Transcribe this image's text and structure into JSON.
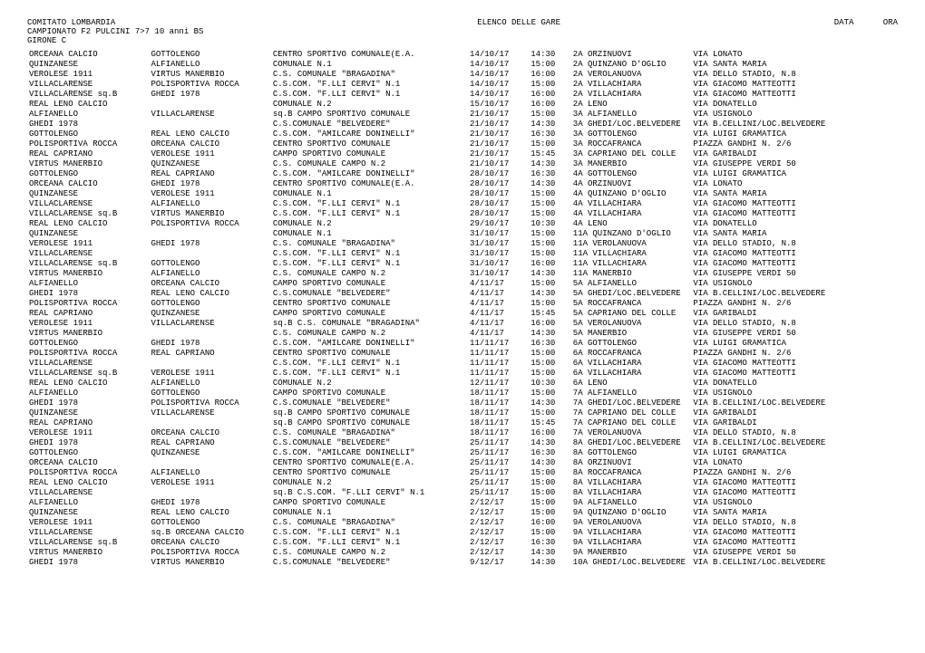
{
  "header": {
    "comitato": "COMITATO LOMBARDIA",
    "elenco": "ELENCO DELLE GARE",
    "campionato": "CAMPIONATO F2 PULCINI 7>7 10 anni    BS",
    "girone": "GIRONE C",
    "data_label": "DATA",
    "ora_label": "ORA"
  },
  "rows": [
    [
      "ORCEANA CALCIO",
      "GOTTOLENGO",
      "CENTRO SPORTIVO COMUNALE(E.A.",
      "14/10/17",
      "14:30",
      "2A ORZINUOVI",
      "VIA LONATO"
    ],
    [
      "QUINZANESE",
      "ALFIANELLO",
      "COMUNALE N.1",
      "14/10/17",
      "15:00",
      "2A QUINZANO D'OGLIO",
      "VIA SANTA MARIA"
    ],
    [
      "VEROLESE 1911",
      "VIRTUS MANERBIO",
      "C.S. COMUNALE \"BRAGADINA\"",
      "14/10/17",
      "16:00",
      "2A VEROLANUOVA",
      "VIA DELLO STADIO, N.8"
    ],
    [
      "VILLACLARENSE",
      "POLISPORTIVA ROCCA",
      "C.S.COM. \"F.LLI CERVI\" N.1",
      "14/10/17",
      "15:00",
      "2A VILLACHIARA",
      "VIA GIACOMO MATTEOTTI"
    ],
    [
      "VILLACLARENSE  sq.B",
      "GHEDI 1978",
      "C.S.COM. \"F.LLI CERVI\" N.1",
      "14/10/17",
      "16:00",
      "2A VILLACHIARA",
      "VIA GIACOMO MATTEOTTI"
    ],
    [
      "REAL LENO CALCIO",
      "",
      "COMUNALE N.2",
      "15/10/17",
      "16:00",
      "2A LENO",
      "VIA DONATELLO"
    ],
    [
      "ALFIANELLO",
      "VILLACLARENSE",
      "sq.B CAMPO SPORTIVO COMUNALE",
      "21/10/17",
      "15:00",
      "3A ALFIANELLO",
      "VIA USIGNOLO"
    ],
    [
      "GHEDI 1978",
      "",
      "C.S.COMUNALE \"BELVEDERE\"",
      "21/10/17",
      "14:30",
      "3A GHEDI/LOC.BELVEDERE",
      "VIA B.CELLINI/LOC.BELVEDERE"
    ],
    [
      "GOTTOLENGO",
      "REAL LENO CALCIO",
      "C.S.COM. \"AMILCARE DONINELLI\"",
      "21/10/17",
      "16:30",
      "3A GOTTOLENGO",
      "VIA LUIGI GRAMATICA"
    ],
    [
      "POLISPORTIVA ROCCA",
      "ORCEANA CALCIO",
      "CENTRO SPORTIVO COMUNALE",
      "21/10/17",
      "15:00",
      "3A ROCCAFRANCA",
      "PIAZZA GANDHI N. 2/6"
    ],
    [
      "REAL CAPRIANO",
      "VEROLESE 1911",
      "CAMPO SPORTIVO COMUNALE",
      "21/10/17",
      "15:45",
      "3A CAPRIANO DEL COLLE",
      "VIA GARIBALDI"
    ],
    [
      "VIRTUS MANERBIO",
      "QUINZANESE",
      "C.S. COMUNALE CAMPO N.2",
      "21/10/17",
      "14:30",
      "3A MANERBIO",
      "VIA GIUSEPPE VERDI 50"
    ],
    [
      "GOTTOLENGO",
      "REAL CAPRIANO",
      "C.S.COM. \"AMILCARE DONINELLI\"",
      "28/10/17",
      "16:30",
      "4A GOTTOLENGO",
      "VIA LUIGI GRAMATICA"
    ],
    [
      "ORCEANA CALCIO",
      "GHEDI 1978",
      "CENTRO SPORTIVO COMUNALE(E.A.",
      "28/10/17",
      "14:30",
      "4A ORZINUOVI",
      "VIA LONATO"
    ],
    [
      "QUINZANESE",
      "VEROLESE 1911",
      "COMUNALE N.1",
      "28/10/17",
      "15:00",
      "4A QUINZANO D'OGLIO",
      "VIA SANTA MARIA"
    ],
    [
      "VILLACLARENSE",
      "ALFIANELLO",
      "C.S.COM. \"F.LLI CERVI\" N.1",
      "28/10/17",
      "15:00",
      "4A VILLACHIARA",
      "VIA GIACOMO MATTEOTTI"
    ],
    [
      "VILLACLARENSE  sq.B",
      "VIRTUS MANERBIO",
      "C.S.COM. \"F.LLI CERVI\" N.1",
      "28/10/17",
      "15:00",
      "4A VILLACHIARA",
      "VIA GIACOMO MATTEOTTI"
    ],
    [
      "REAL LENO CALCIO",
      "POLISPORTIVA ROCCA",
      "COMUNALE N.2",
      "29/10/17",
      "10:30",
      "4A LENO",
      "VIA DONATELLO"
    ],
    [
      "QUINZANESE",
      "",
      "COMUNALE N.1",
      "31/10/17",
      "15:00",
      "11A QUINZANO D'OGLIO",
      "VIA SANTA MARIA"
    ],
    [
      "VEROLESE 1911",
      "GHEDI 1978",
      "C.S. COMUNALE \"BRAGADINA\"",
      "31/10/17",
      "15:00",
      "11A VEROLANUOVA",
      "VIA DELLO STADIO, N.8"
    ],
    [
      "VILLACLARENSE",
      "",
      "C.S.COM. \"F.LLI CERVI\" N.1",
      "31/10/17",
      "15:00",
      "11A VILLACHIARA",
      "VIA GIACOMO MATTEOTTI"
    ],
    [
      "VILLACLARENSE  sq.B",
      "GOTTOLENGO",
      "C.S.COM. \"F.LLI CERVI\" N.1",
      "31/10/17",
      "16:00",
      "11A VILLACHIARA",
      "VIA GIACOMO MATTEOTTI"
    ],
    [
      "VIRTUS MANERBIO",
      "ALFIANELLO",
      "C.S. COMUNALE CAMPO N.2",
      "31/10/17",
      "14:30",
      "11A MANERBIO",
      "VIA GIUSEPPE VERDI 50"
    ],
    [
      "ALFIANELLO",
      "ORCEANA CALCIO",
      "CAMPO SPORTIVO COMUNALE",
      "4/11/17",
      "15:00",
      "5A ALFIANELLO",
      "VIA USIGNOLO"
    ],
    [
      "GHEDI 1978",
      "REAL LENO CALCIO",
      "C.S.COMUNALE \"BELVEDERE\"",
      "4/11/17",
      "14:30",
      "5A GHEDI/LOC.BELVEDERE",
      "VIA B.CELLINI/LOC.BELVEDERE"
    ],
    [
      "POLISPORTIVA ROCCA",
      "GOTTOLENGO",
      "CENTRO SPORTIVO COMUNALE",
      "4/11/17",
      "15:00",
      "5A ROCCAFRANCA",
      "PIAZZA GANDHI N. 2/6"
    ],
    [
      "REAL CAPRIANO",
      "QUINZANESE",
      "CAMPO SPORTIVO COMUNALE",
      "4/11/17",
      "15:45",
      "5A CAPRIANO DEL COLLE",
      "VIA GARIBALDI"
    ],
    [
      "VEROLESE 1911",
      "VILLACLARENSE",
      "sq.B C.S. COMUNALE \"BRAGADINA\"",
      "4/11/17",
      "16:00",
      "5A VEROLANUOVA",
      "VIA DELLO STADIO, N.8"
    ],
    [
      "VIRTUS MANERBIO",
      "",
      "C.S. COMUNALE CAMPO N.2",
      "4/11/17",
      "14:30",
      "5A MANERBIO",
      "VIA GIUSEPPE VERDI 50"
    ],
    [
      "GOTTOLENGO",
      "GHEDI 1978",
      "C.S.COM. \"AMILCARE DONINELLI\"",
      "11/11/17",
      "16:30",
      "6A GOTTOLENGO",
      "VIA LUIGI GRAMATICA"
    ],
    [
      "POLISPORTIVA ROCCA",
      "REAL CAPRIANO",
      "CENTRO SPORTIVO COMUNALE",
      "11/11/17",
      "15:00",
      "6A ROCCAFRANCA",
      "PIAZZA GANDHI N. 2/6"
    ],
    [
      "VILLACLARENSE",
      "",
      "C.S.COM. \"F.LLI CERVI\" N.1",
      "11/11/17",
      "15:00",
      "6A VILLACHIARA",
      "VIA GIACOMO MATTEOTTI"
    ],
    [
      "VILLACLARENSE  sq.B",
      "VEROLESE 1911",
      "C.S.COM. \"F.LLI CERVI\" N.1",
      "11/11/17",
      "15:00",
      "6A VILLACHIARA",
      "VIA GIACOMO MATTEOTTI"
    ],
    [
      "REAL LENO CALCIO",
      "ALFIANELLO",
      "COMUNALE N.2",
      "12/11/17",
      "10:30",
      "6A LENO",
      "VIA DONATELLO"
    ],
    [
      "ALFIANELLO",
      "GOTTOLENGO",
      "CAMPO SPORTIVO COMUNALE",
      "18/11/17",
      "15:00",
      "7A ALFIANELLO",
      "VIA USIGNOLO"
    ],
    [
      "GHEDI 1978",
      "POLISPORTIVA ROCCA",
      "C.S.COMUNALE \"BELVEDERE\"",
      "18/11/17",
      "14:30",
      "7A GHEDI/LOC.BELVEDERE",
      "VIA B.CELLINI/LOC.BELVEDERE"
    ],
    [
      "QUINZANESE",
      "VILLACLARENSE",
      "sq.B CAMPO SPORTIVO COMUNALE",
      "18/11/17",
      "15:00",
      "7A CAPRIANO DEL COLLE",
      "VIA GARIBALDI"
    ],
    [
      "REAL CAPRIANO",
      "",
      "sq.B CAMPO SPORTIVO COMUNALE",
      "18/11/17",
      "15:45",
      "7A CAPRIANO DEL COLLE",
      "VIA GARIBALDI"
    ],
    [
      "VEROLESE 1911",
      "ORCEANA CALCIO",
      "C.S. COMUNALE \"BRAGADINA\"",
      "18/11/17",
      "16:00",
      "7A VEROLANUOVA",
      "VIA DELLO STADIO, N.8"
    ],
    [
      "GHEDI 1978",
      "REAL CAPRIANO",
      "C.S.COMUNALE \"BELVEDERE\"",
      "25/11/17",
      "14:30",
      "8A GHEDI/LOC.BELVEDERE",
      "VIA B.CELLINI/LOC.BELVEDERE"
    ],
    [
      "GOTTOLENGO",
      "QUINZANESE",
      "C.S.COM. \"AMILCARE DONINELLI\"",
      "25/11/17",
      "16:30",
      "8A GOTTOLENGO",
      "VIA LUIGI GRAMATICA"
    ],
    [
      "ORCEANA CALCIO",
      "",
      "CENTRO SPORTIVO COMUNALE(E.A.",
      "25/11/17",
      "14:30",
      "8A ORZINUOVI",
      "VIA LONATO"
    ],
    [
      "POLISPORTIVA ROCCA",
      "ALFIANELLO",
      "CENTRO SPORTIVO COMUNALE",
      "25/11/17",
      "15:00",
      "8A ROCCAFRANCA",
      "PIAZZA GANDHI N. 2/6"
    ],
    [
      "REAL LENO CALCIO",
      "VEROLESE 1911",
      "COMUNALE N.2",
      "25/11/17",
      "15:00",
      "8A VILLACHIARA",
      "VIA GIACOMO MATTEOTTI"
    ],
    [
      "VILLACLARENSE",
      "",
      "sq.B C.S.COM. \"F.LLI CERVI\" N.1",
      "25/11/17",
      "15:00",
      "8A VILLACHIARA",
      "VIA GIACOMO MATTEOTTI"
    ],
    [
      "ALFIANELLO",
      "GHEDI 1978",
      "CAMPO SPORTIVO COMUNALE",
      "2/12/17",
      "15:00",
      "9A ALFIANELLO",
      "VIA USIGNOLO"
    ],
    [
      "QUINZANESE",
      "REAL LENO CALCIO",
      "COMUNALE N.1",
      "2/12/17",
      "15:00",
      "9A QUINZANO D'OGLIO",
      "VIA SANTA MARIA"
    ],
    [
      "VEROLESE 1911",
      "GOTTOLENGO",
      "C.S. COMUNALE \"BRAGADINA\"",
      "2/12/17",
      "16:00",
      "9A VEROLANUOVA",
      "VIA DELLO STADIO, N.8"
    ],
    [
      "VILLACLARENSE",
      "sq.B ORCEANA CALCIO",
      "C.S.COM. \"F.LLI CERVI\" N.1",
      "2/12/17",
      "15:00",
      "9A VILLACHIARA",
      "VIA GIACOMO MATTEOTTI"
    ],
    [
      "VILLACLARENSE  sq.B",
      "ORCEANA CALCIO",
      "C.S.COM. \"F.LLI CERVI\" N.1",
      "2/12/17",
      "16:30",
      "9A VILLACHIARA",
      "VIA GIACOMO MATTEOTTI"
    ],
    [
      "VIRTUS MANERBIO",
      "POLISPORTIVA ROCCA",
      "C.S. COMUNALE CAMPO N.2",
      "2/12/17",
      "14:30",
      "9A MANERBIO",
      "VIA GIUSEPPE VERDI 50"
    ],
    [
      "GHEDI 1978",
      "VIRTUS MANERBIO",
      "C.S.COMUNALE \"BELVEDERE\"",
      "9/12/17",
      "14:30",
      "10A GHEDI/LOC.BELVEDERE",
      "VIA B.CELLINI/LOC.BELVEDERE"
    ]
  ]
}
